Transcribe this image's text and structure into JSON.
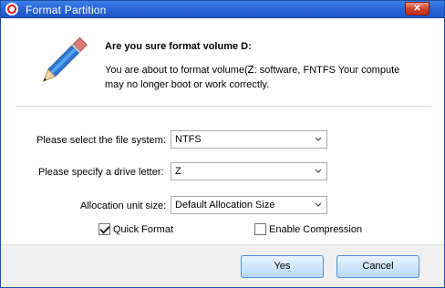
{
  "window": {
    "title": "Format Partition",
    "close_label": "✕"
  },
  "dialog": {
    "headline": "Are you sure format volume D:",
    "message": "You are about to format volume(Ꮓ:  software, FNTFS  Your compute may no longer boot or work correctly."
  },
  "form": {
    "file_system": {
      "label": "Please select the file system:",
      "value": "NTFS"
    },
    "drive_letter": {
      "label": "Please specify a drive letter:",
      "value": "Z"
    },
    "allocation": {
      "label": "Allocation unit size:",
      "value": "Default Allocation Size"
    },
    "quick_format": {
      "label": "Quick Format",
      "checked": true
    },
    "compression": {
      "label": "Enable Compression",
      "checked": false
    }
  },
  "buttons": {
    "yes": "Yes",
    "cancel": "Cancel"
  },
  "colors": {
    "titlebar": "#2a67d8",
    "close": "#d0432c",
    "button_border": "#4d8fd3"
  }
}
